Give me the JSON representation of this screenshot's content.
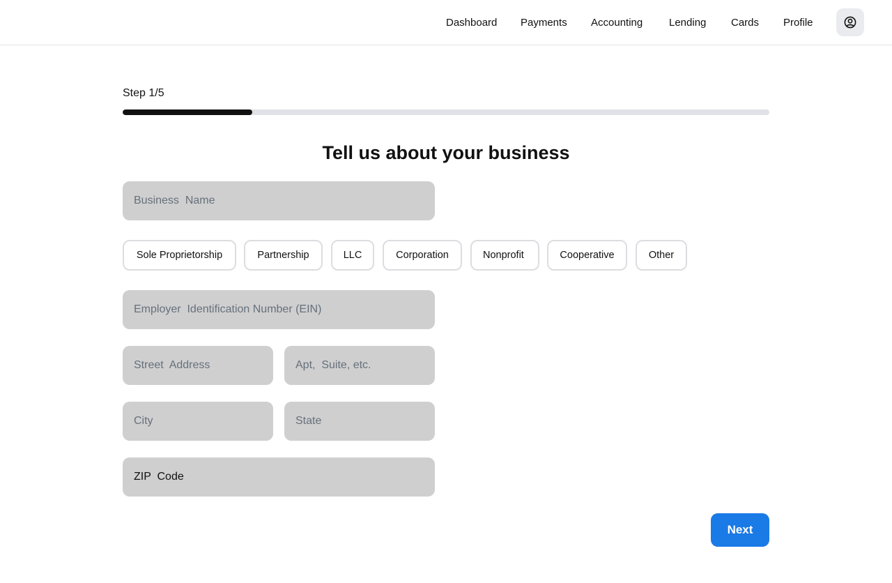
{
  "nav": {
    "items": [
      "Dashboard",
      "Payments",
      "Accounting",
      "Lending",
      "Cards",
      "Profile"
    ]
  },
  "progress": {
    "label": "Step 1/5",
    "fraction": 0.2
  },
  "form": {
    "title": "Tell us about your business",
    "business_name": {
      "placeholder": "Business  Name",
      "value": ""
    },
    "business_types": [
      "Sole Proprietorship",
      "Partnership",
      "LLC",
      "Corporation",
      "Nonprofit",
      "Cooperative",
      "Other"
    ],
    "ein": {
      "placeholder": "Employer  Identification Number (EIN)",
      "value": ""
    },
    "street": {
      "placeholder": "Street  Address",
      "value": ""
    },
    "apt": {
      "placeholder": "Apt,  Suite, etc.",
      "value": ""
    },
    "city": {
      "placeholder": "City",
      "value": ""
    },
    "state": {
      "placeholder": "State",
      "value": ""
    },
    "zip": {
      "placeholder": "ZIP  Code",
      "value": "ZIP  Code"
    },
    "next_label": "Next"
  },
  "icons": {
    "profile": "user-circle-icon"
  },
  "colors": {
    "primary": "#1a7ae6",
    "progress_fill": "#111111",
    "progress_track": "#dfe2e6",
    "field_bg": "#cfcfcf"
  }
}
